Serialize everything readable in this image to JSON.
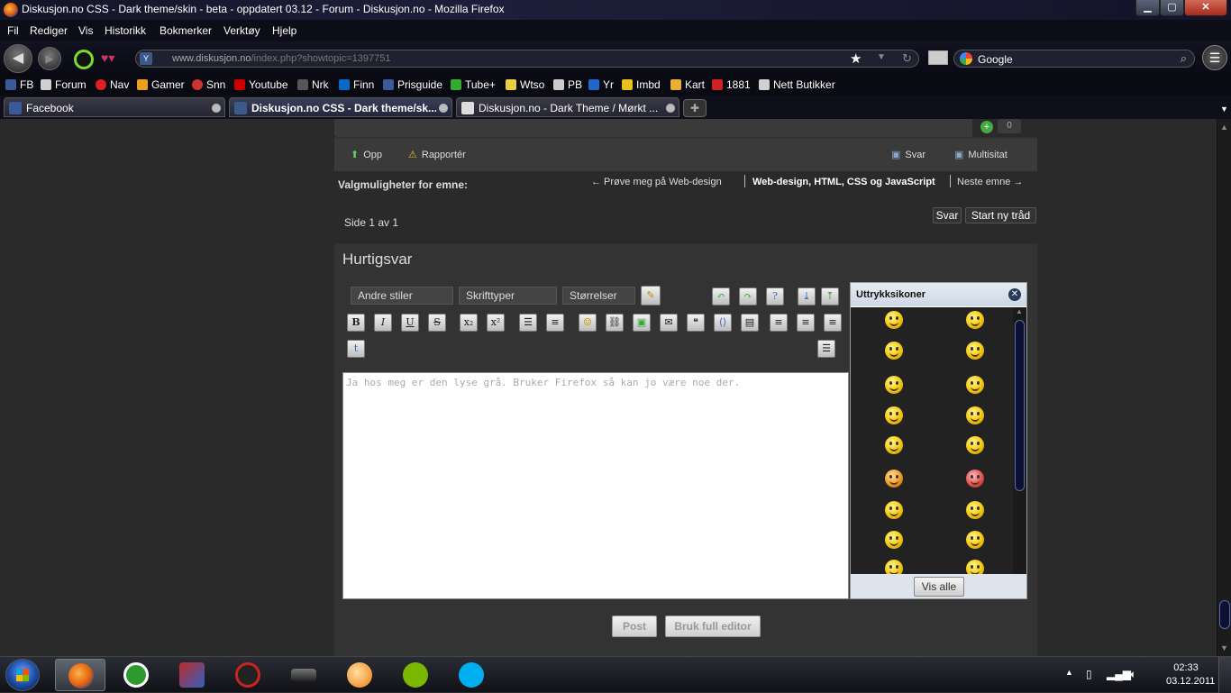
{
  "window": {
    "title": "Diskusjon.no CSS - Dark theme/skin - beta - oppdatert 03.12 - Forum - Diskusjon.no - Mozilla Firefox",
    "min_glyph": "▁",
    "max_glyph": "▢",
    "close_glyph": "✕"
  },
  "menu": [
    "Fil",
    "Rediger",
    "Vis",
    "Historikk",
    "Bokmerker",
    "Verktøy",
    "Hjelp"
  ],
  "navigation": {
    "url_domain": "www.diskusjon.no",
    "url_path": "/index.php?showtopic=1397751",
    "search_engine": "Google"
  },
  "bookmarks": [
    {
      "label": "FB",
      "color": "#3b5998"
    },
    {
      "label": "Forum",
      "color": "#d0d0d0"
    },
    {
      "label": "Nav",
      "color": "#d22"
    },
    {
      "label": "Gamer",
      "color": "#e8a020"
    },
    {
      "label": "Snn",
      "color": "#c33"
    },
    {
      "label": "Youtube",
      "color": "#c00"
    },
    {
      "label": "Nrk",
      "color": "#333"
    },
    {
      "label": "Finn",
      "color": "#0a68c8"
    },
    {
      "label": "Prisguide",
      "color": "#3a5a9a"
    },
    {
      "label": "Tube+",
      "color": "#3a3"
    },
    {
      "label": "Wtso",
      "color": "#e8d040"
    },
    {
      "label": "PB",
      "color": "#ccc"
    },
    {
      "label": "Yr",
      "color": "#2266cc"
    },
    {
      "label": "Imbd",
      "color": "#e8c020"
    },
    {
      "label": "Kart",
      "color": "#e8b030"
    },
    {
      "label": "1881",
      "color": "#cc2222"
    },
    {
      "label": "Nett Butikker",
      "color": "#d0d0d0"
    }
  ],
  "tabs": [
    {
      "label": "Facebook",
      "active": false,
      "icon_color": "#3b5998"
    },
    {
      "label": "Diskusjon.no CSS - Dark theme/sk...",
      "active": true,
      "icon_color": "#3a5a8a"
    },
    {
      "label": "Diskusjon.no - Dark Theme / Mørkt ...",
      "active": false,
      "icon_color": "#ddd"
    }
  ],
  "post": {
    "rep_count": "0",
    "actions": {
      "up": "Opp",
      "report": "Rapportér",
      "reply": "Svar",
      "multiquote": "Multisitat"
    }
  },
  "topic_options": {
    "label": "Valgmuligheter for emne:",
    "prev": "← Prøve meg på Web-design",
    "current": "Web-design, HTML, CSS og JavaScript",
    "next": "Neste emne →",
    "page_info": "Side 1 av 1",
    "reply_btn": "Svar",
    "new_topic_btn": "Start ny tråd"
  },
  "quick_reply": {
    "title": "Hurtigsvar",
    "styles_combo": "Andre stiler",
    "font_combo": "Skrifttyper",
    "size_combo": "Størrelser",
    "text": "Ja hos meg er den lyse grå. Bruker Firefox så kan jo være noe der.",
    "post_btn": "Post",
    "full_editor_btn": "Bruk full editor"
  },
  "smilies": {
    "title": "Uttrykksikoner",
    "show_all": "Vis alle",
    "count": 18
  },
  "taskbar": {
    "time": "02:33",
    "date": "03.12.2011",
    "apps": [
      {
        "name": "firefox",
        "color": "#e06010",
        "active": true
      },
      {
        "name": "utorrent",
        "color": "#2e9a2e",
        "active": false
      },
      {
        "name": "winrar",
        "color": "#c02a2a",
        "active": false
      },
      {
        "name": "blocked-app",
        "color": "#aa2222",
        "active": false
      },
      {
        "name": "ps3-app",
        "color": "#555",
        "active": false
      },
      {
        "name": "origin-app",
        "color": "#f07a10",
        "active": false
      },
      {
        "name": "spotify",
        "color": "#7ab800",
        "active": false
      },
      {
        "name": "skype",
        "color": "#00aff0",
        "active": false
      }
    ]
  }
}
